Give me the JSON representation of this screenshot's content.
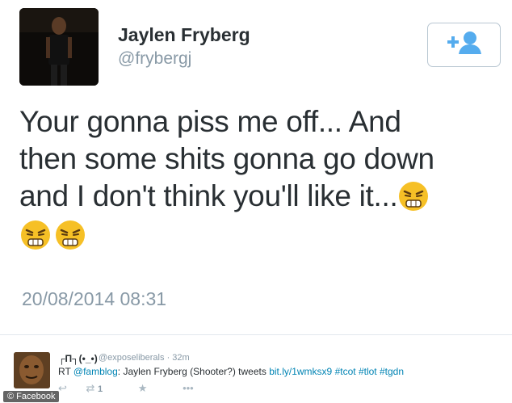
{
  "author": {
    "name": "Jaylen Fryberg",
    "handle": "@frybergj"
  },
  "follow_button": {
    "icon": "add-user-icon",
    "color": "#55acee"
  },
  "tweet": {
    "line1": "Your gonna piss me off... And",
    "line2": "then some shits gonna go down",
    "line3": "and I don't think you'll like it...",
    "emoji": "persevering-face-emoji",
    "timestamp": "20/08/2014 08:31"
  },
  "embedded_tweet": {
    "name": "┌П┐(•_•)",
    "handle": "@exposeliberals",
    "time": "· 32m",
    "text_prefix": "RT ",
    "mention": "@famblog",
    "text_body": ": Jaylen Fryberg (Shooter?)  tweets ",
    "link": "bit.ly/1wmksx9",
    "hashtag1": "#tcot",
    "hashtag2": "#tlot",
    "hashtag3": "#tgdn",
    "retweet_count": "1",
    "link_color": "#0084b4"
  },
  "watermark": "© Facebook"
}
